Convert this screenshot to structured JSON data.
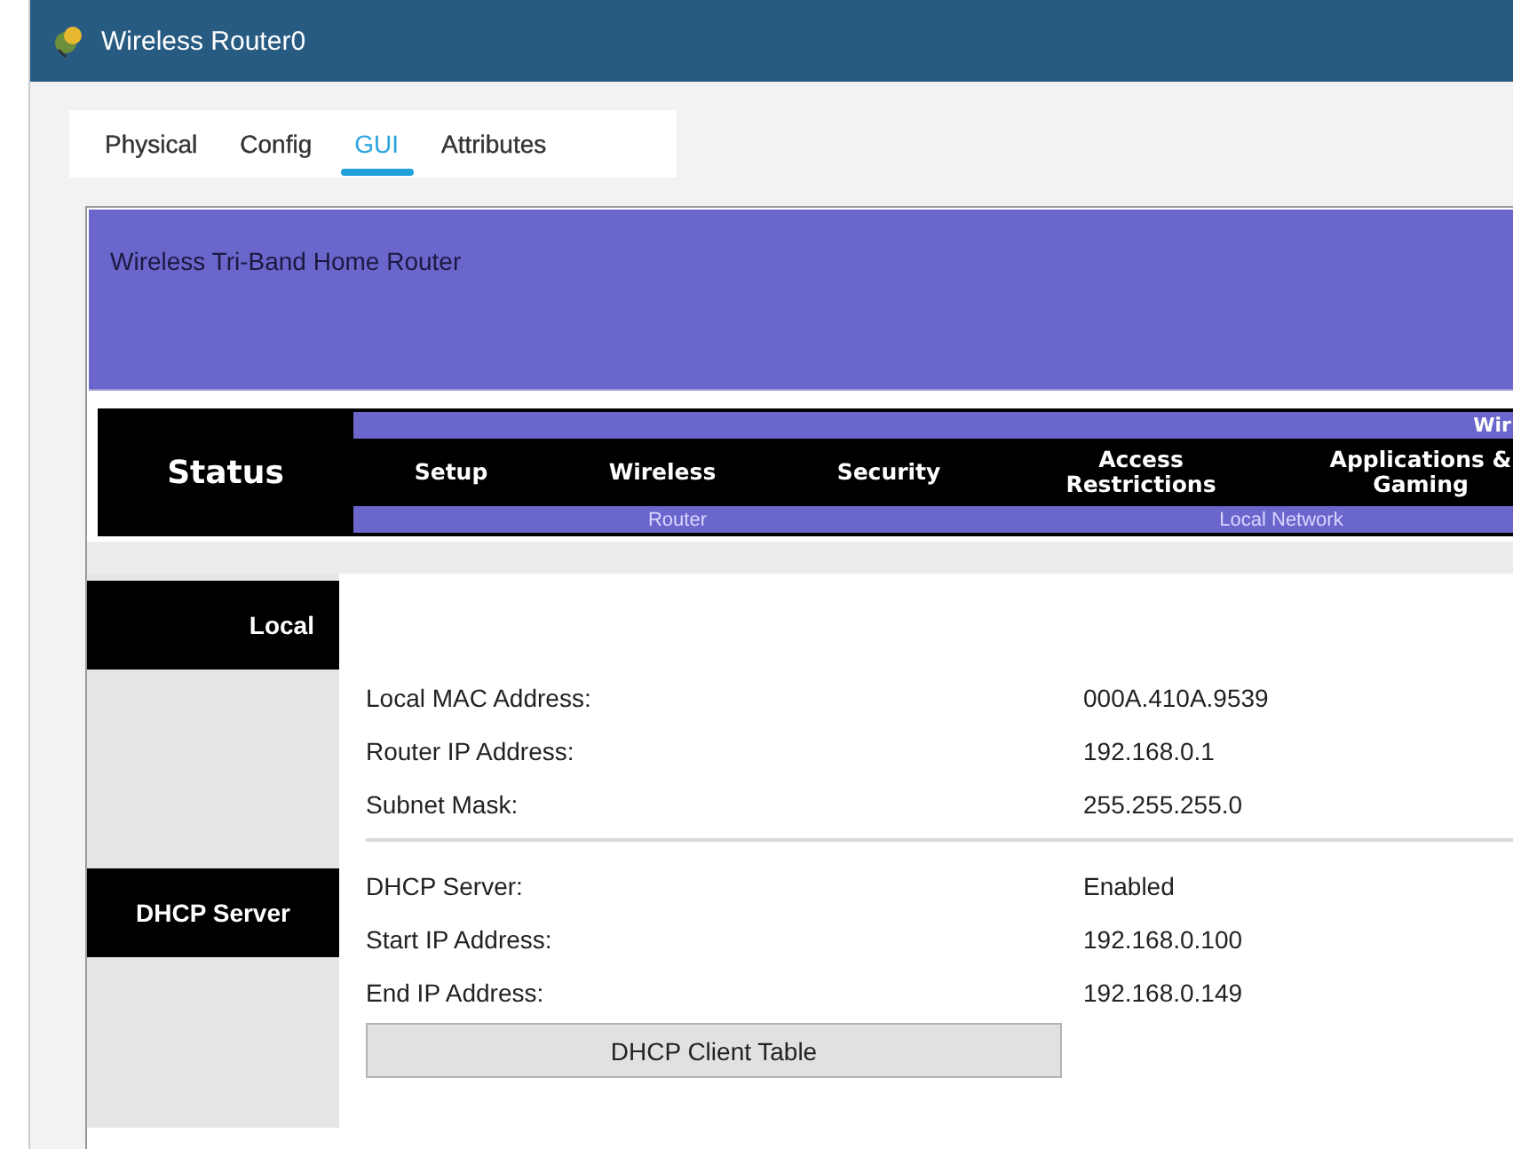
{
  "window": {
    "title": "Wireless Router0"
  },
  "tabs": [
    {
      "label": "Physical",
      "selected": false
    },
    {
      "label": "Config",
      "selected": false
    },
    {
      "label": "GUI",
      "selected": true
    },
    {
      "label": "Attributes",
      "selected": false
    }
  ],
  "banner": {
    "title": "Wireless Tri-Band Home Router"
  },
  "nav": {
    "current": "Status",
    "top_label": "Wir",
    "items": [
      {
        "label": "Setup"
      },
      {
        "label": "Wireless"
      },
      {
        "label": "Security"
      },
      {
        "label": "Access Restrictions"
      },
      {
        "label": "Applications & Gaming"
      }
    ],
    "sub_labels": [
      "Router",
      "Local Network"
    ]
  },
  "sections": [
    {
      "title": "Local",
      "rows": [
        {
          "label": "Local MAC Address:",
          "value": "000A.410A.9539"
        },
        {
          "label": "Router IP Address:",
          "value": "192.168.0.1"
        },
        {
          "label": "Subnet Mask:",
          "value": "255.255.255.0"
        }
      ]
    },
    {
      "title": "DHCP Server",
      "rows": [
        {
          "label": "DHCP Server:",
          "value": "Enabled"
        },
        {
          "label": "Start IP Address:",
          "value": "192.168.0.100"
        },
        {
          "label": "End IP Address:",
          "value": "192.168.0.149"
        }
      ],
      "button": "DHCP Client Table"
    }
  ]
}
